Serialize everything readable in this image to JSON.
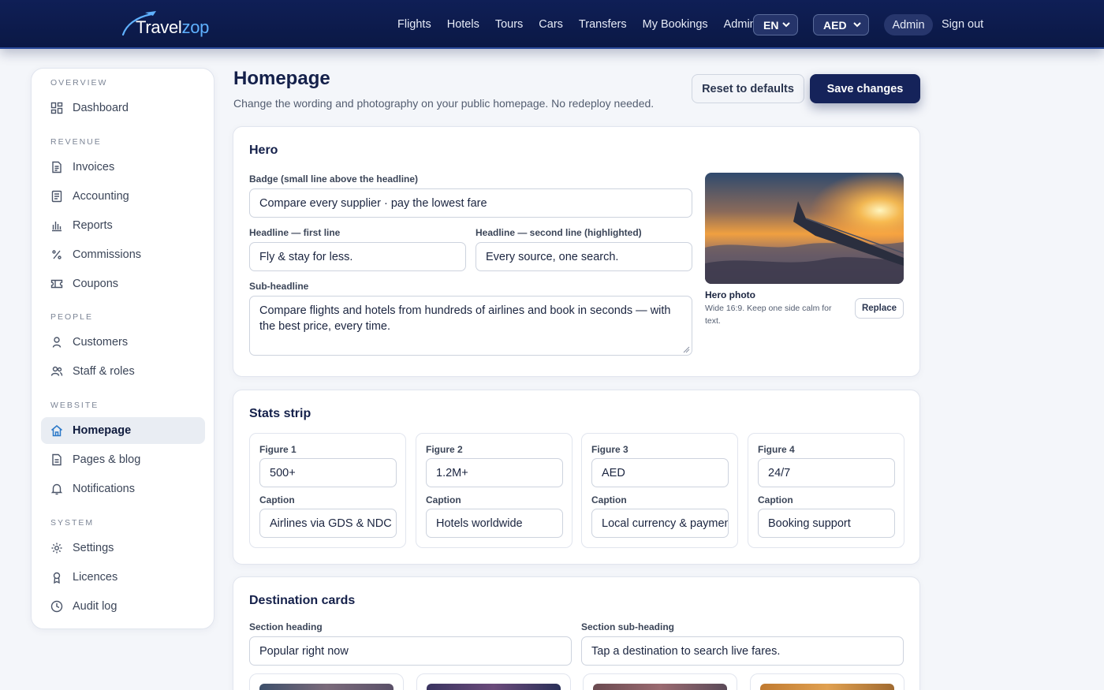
{
  "brand": {
    "name_part1": "Travel",
    "name_part2": "zop"
  },
  "nav": {
    "links": [
      "Flights",
      "Hotels",
      "Tours",
      "Cars",
      "Transfers",
      "My Bookings",
      "Admin"
    ],
    "language": "EN",
    "currency": "AED",
    "user": "Admin",
    "signout": "Sign out"
  },
  "sidebar": {
    "sections": [
      {
        "title": "Overview",
        "items": [
          {
            "label": "Dashboard",
            "icon": "grid-icon"
          }
        ]
      },
      {
        "title": "Revenue",
        "items": [
          {
            "label": "Invoices",
            "icon": "invoice-icon"
          },
          {
            "label": "Accounting",
            "icon": "ledger-icon"
          },
          {
            "label": "Reports",
            "icon": "bar-chart-icon"
          },
          {
            "label": "Commissions",
            "icon": "percent-icon"
          },
          {
            "label": "Coupons",
            "icon": "ticket-icon"
          }
        ]
      },
      {
        "title": "People",
        "items": [
          {
            "label": "Customers",
            "icon": "user-icon"
          },
          {
            "label": "Staff & roles",
            "icon": "users-icon"
          }
        ]
      },
      {
        "title": "Website",
        "items": [
          {
            "label": "Homepage",
            "icon": "home-icon",
            "active": true
          },
          {
            "label": "Pages & blog",
            "icon": "document-icon"
          },
          {
            "label": "Notifications",
            "icon": "bell-icon"
          }
        ]
      },
      {
        "title": "System",
        "items": [
          {
            "label": "Settings",
            "icon": "gear-icon"
          },
          {
            "label": "Licences",
            "icon": "award-icon"
          },
          {
            "label": "Audit log",
            "icon": "clock-icon"
          }
        ]
      }
    ]
  },
  "page": {
    "title": "Homepage",
    "subtitle": "Change the wording and photography on your public homepage. No redeploy needed.",
    "reset_label": "Reset to defaults",
    "save_label": "Save changes"
  },
  "hero": {
    "title": "Hero",
    "badge_label": "Badge (small line above the headline)",
    "badge_value": "Compare every supplier · pay the lowest fare",
    "headline1_label": "Headline — first line",
    "headline1_value": "Fly & stay for less.",
    "headline2_label": "Headline — second line (highlighted)",
    "headline2_value": "Every source, one search.",
    "subheadline_label": "Sub-headline",
    "subheadline_value": "Compare flights and hotels from hundreds of airlines and book in seconds — with the best price, every time.",
    "photo_title": "Hero photo",
    "photo_hint": "Wide 16:9. Keep one side calm for text.",
    "replace_label": "Replace"
  },
  "stats": {
    "title": "Stats strip",
    "caption_label": "Caption",
    "figures": [
      {
        "label": "Figure 1",
        "value": "500+",
        "caption": "Airlines via GDS & NDC"
      },
      {
        "label": "Figure 2",
        "value": "1.2M+",
        "caption": "Hotels worldwide"
      },
      {
        "label": "Figure 3",
        "value": "AED",
        "caption": "Local currency & payments"
      },
      {
        "label": "Figure 4",
        "value": "24/7",
        "caption": "Booking support"
      }
    ]
  },
  "destinations": {
    "title": "Destination cards",
    "heading_label": "Section heading",
    "heading_value": "Popular right now",
    "subheading_label": "Section sub-heading",
    "subheading_value": "Tap a destination to search live fares."
  },
  "colors": {
    "navbar": "#0f1f56",
    "primary_button": "#15235a",
    "accent_logo": "#5fb1ff",
    "active_nav_bg": "#e9edf3"
  }
}
